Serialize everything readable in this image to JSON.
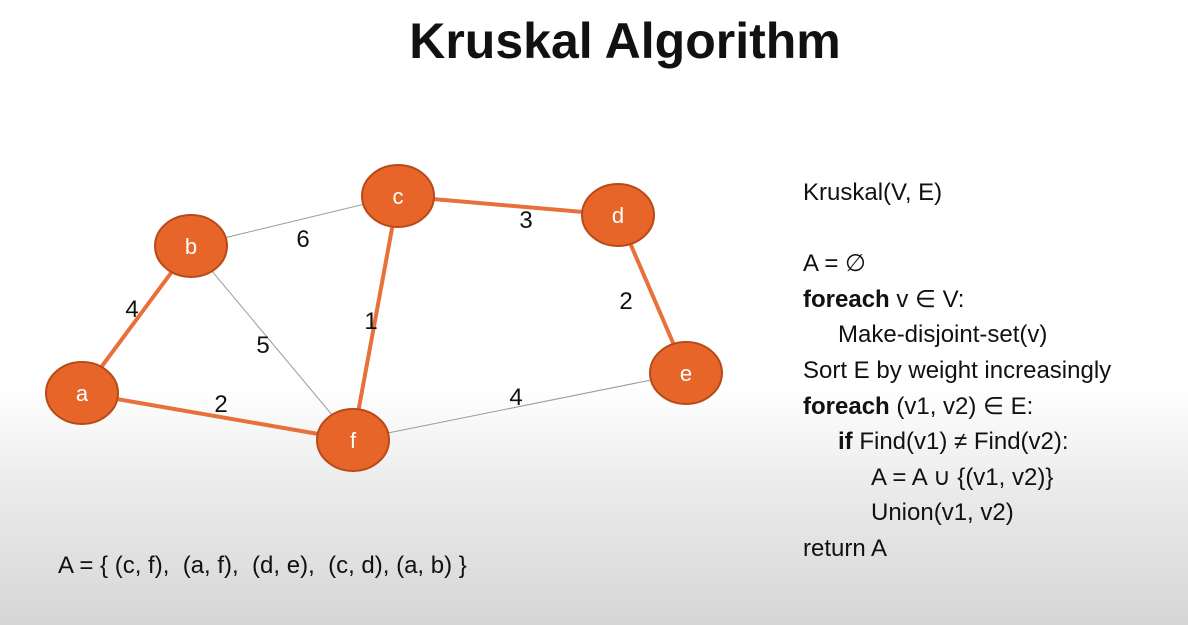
{
  "title": "Kruskal Algorithm",
  "graph": {
    "nodes": [
      "a",
      "b",
      "c",
      "d",
      "e",
      "f"
    ],
    "edges": [
      {
        "from": "b",
        "to": "c",
        "weight": "6",
        "in_mst": false
      },
      {
        "from": "b",
        "to": "f",
        "weight": "5",
        "in_mst": false
      },
      {
        "from": "f",
        "to": "e",
        "weight": "4",
        "in_mst": false
      },
      {
        "from": "a",
        "to": "b",
        "weight": "4",
        "in_mst": true
      },
      {
        "from": "a",
        "to": "f",
        "weight": "2",
        "in_mst": true
      },
      {
        "from": "c",
        "to": "f",
        "weight": "1",
        "in_mst": true
      },
      {
        "from": "c",
        "to": "d",
        "weight": "3",
        "in_mst": true
      },
      {
        "from": "d",
        "to": "e",
        "weight": "2",
        "in_mst": true
      }
    ],
    "colors": {
      "node_fill": "#e8652a",
      "node_stroke": "#b84a18",
      "mst_edge": "#e8703a",
      "other_edge": "#9a9a9a"
    }
  },
  "pseudocode": {
    "header": "Kruskal(V, E)",
    "l1": "A = ∅",
    "l2_kw": "foreach",
    "l2_rest": " v ∈ V:",
    "l3": "Make-disjoint-set(v)",
    "l4": "Sort E by weight increasingly",
    "l5_kw": "foreach",
    "l5_rest": " (v1, v2) ∈ E:",
    "l6_kw": "if",
    "l6_rest": " Find(v1) ≠ Find(v2):",
    "l7": "A = A ∪ {(v1, v2)}",
    "l8": "Union(v1, v2)",
    "l9": "return A"
  },
  "result": "A = { (c, f),  (a, f),  (d, e),  (c, d), (a, b) }"
}
